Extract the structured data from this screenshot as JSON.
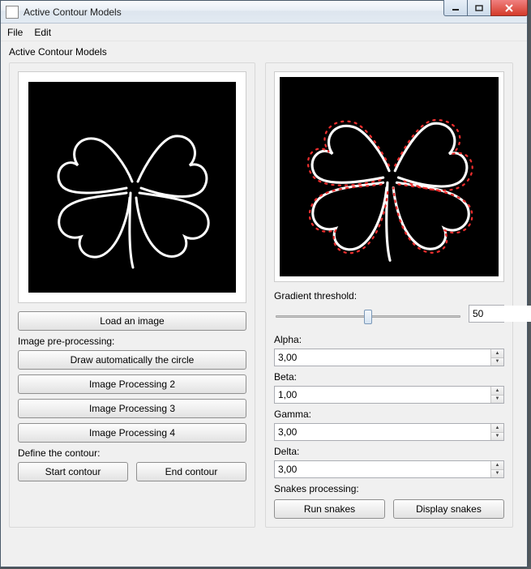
{
  "window": {
    "title": "Active Contour Models"
  },
  "menu": {
    "file": "File",
    "edit": "Edit"
  },
  "subtitle": "Active Contour Models",
  "left": {
    "load_btn": "Load an image",
    "preproc_label": "Image pre-processing:",
    "draw_circle_btn": "Draw automatically the circle",
    "proc2_btn": "Image Processing 2",
    "proc3_btn": "Image Processing 3",
    "proc4_btn": "Image Processing 4",
    "define_label": "Define the contour:",
    "start_btn": "Start contour",
    "end_btn": "End contour"
  },
  "right": {
    "grad_label": "Gradient threshold:",
    "grad_value": "50",
    "alpha_label": "Alpha:",
    "alpha_value": "3,00",
    "beta_label": "Beta:",
    "beta_value": "1,00",
    "gamma_label": "Gamma:",
    "gamma_value": "3,00",
    "delta_label": "Delta:",
    "delta_value": "3,00",
    "snakes_label": "Snakes processing:",
    "run_btn": "Run snakes",
    "display_btn": "Display snakes"
  },
  "colors": {
    "accent_red": "#e82c2c"
  }
}
